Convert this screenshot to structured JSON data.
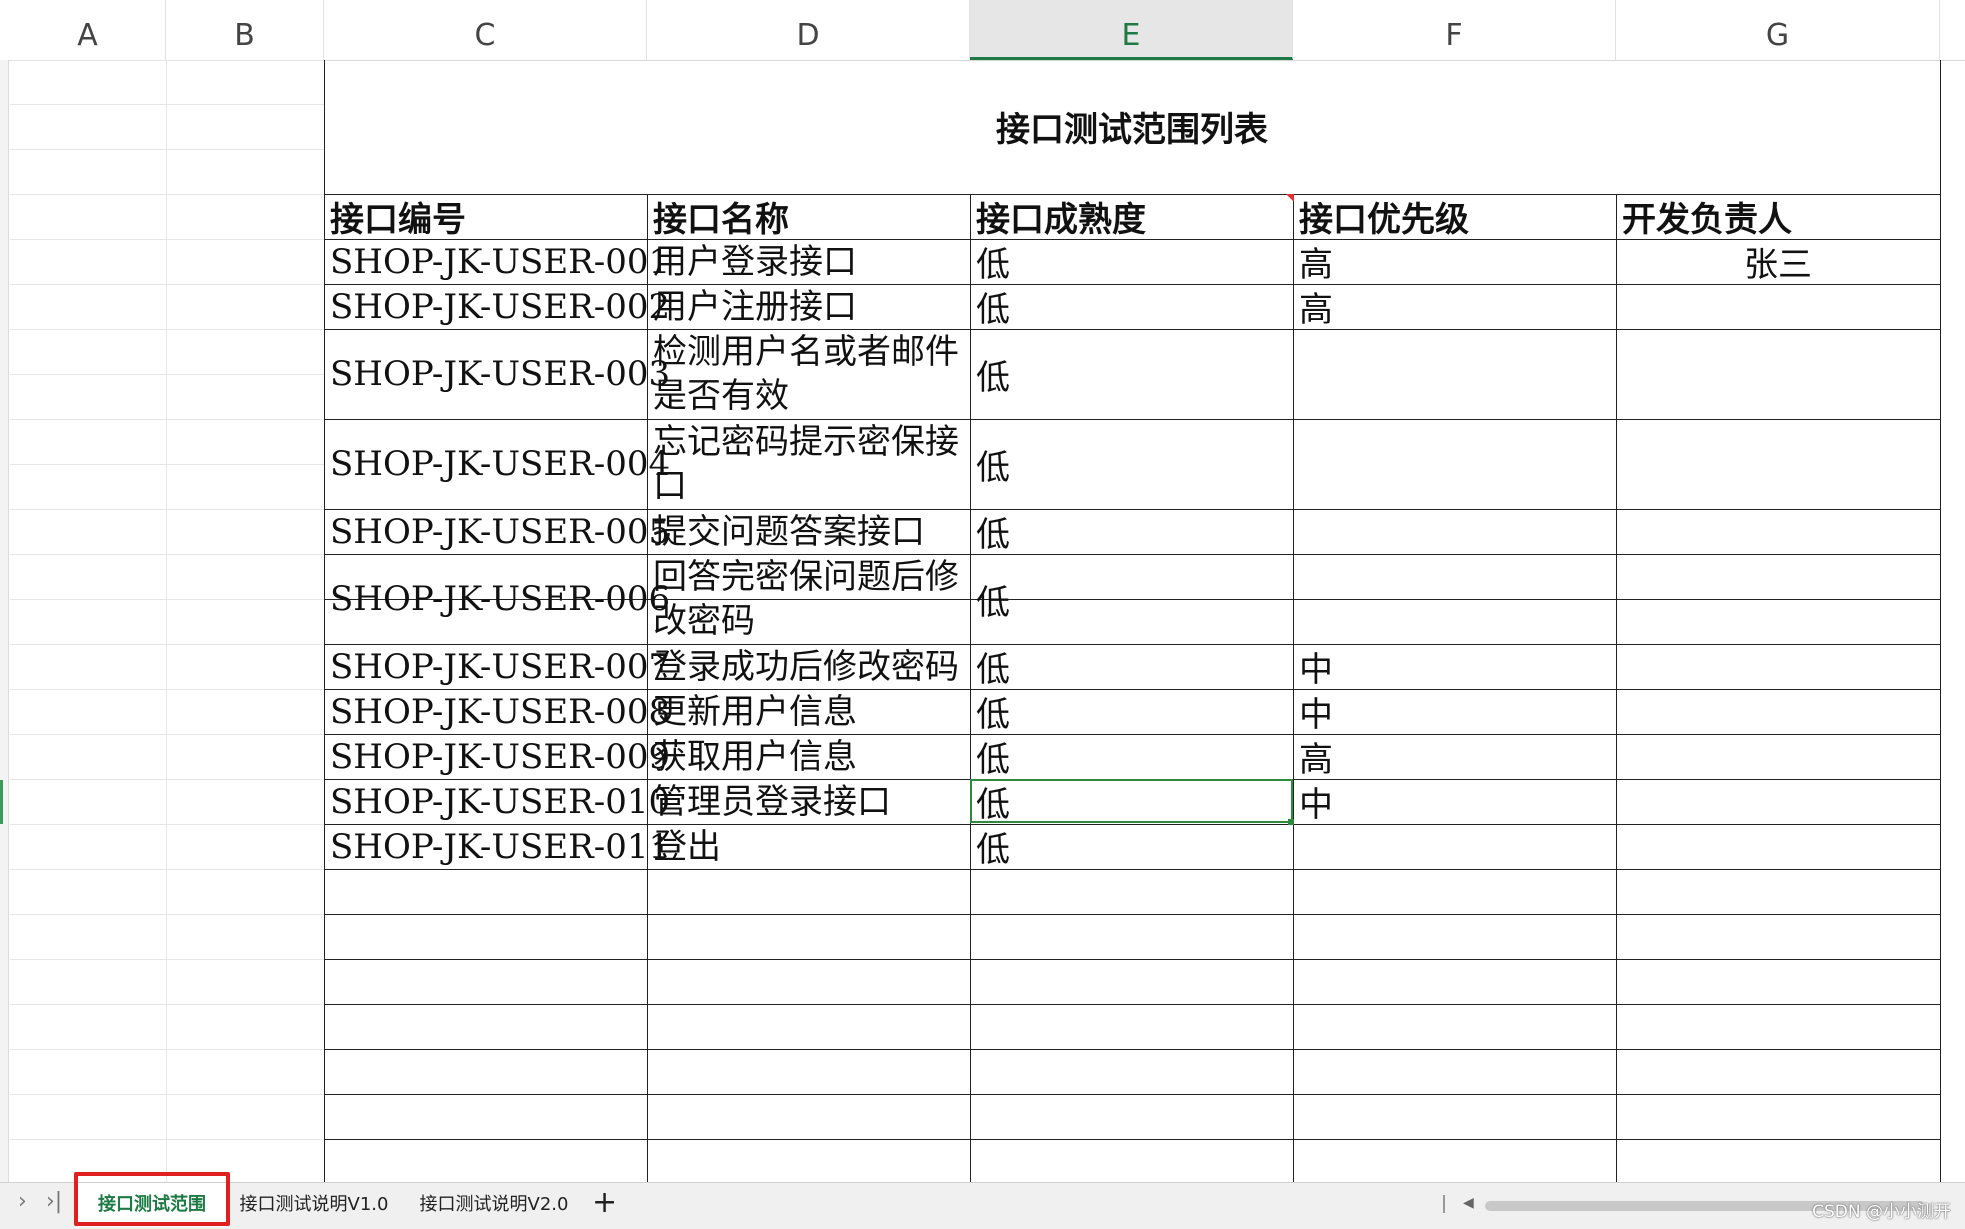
{
  "columns": [
    "A",
    "B",
    "C",
    "D",
    "E",
    "F",
    "G"
  ],
  "active_column": "E",
  "title": "接口测试范围列表",
  "headers": [
    "接口编号",
    "接口名称",
    "接口成熟度",
    "接口优先级",
    "开发负责人"
  ],
  "rows": [
    {
      "id": "SHOP-JK-USER-001",
      "name": "用户登录接口",
      "maturity": "低",
      "priority": "高",
      "owner": "张三"
    },
    {
      "id": "SHOP-JK-USER-002",
      "name": "用户注册接口",
      "maturity": "低",
      "priority": "高",
      "owner": ""
    },
    {
      "id": "SHOP-JK-USER-003",
      "name": "检测用户名或者邮件是否有效",
      "maturity": "低",
      "priority": "",
      "owner": ""
    },
    {
      "id": "SHOP-JK-USER-004",
      "name": "忘记密码提示密保接口",
      "maturity": "低",
      "priority": "",
      "owner": ""
    },
    {
      "id": "SHOP-JK-USER-005",
      "name": "提交问题答案接口",
      "maturity": "低",
      "priority": "",
      "owner": ""
    },
    {
      "id": "SHOP-JK-USER-006",
      "name": "回答完密保问题后修改密码",
      "maturity": "低",
      "priority": "",
      "owner": ""
    },
    {
      "id": "SHOP-JK-USER-007",
      "name": "登录成功后修改密码",
      "maturity": "低",
      "priority": "中",
      "owner": ""
    },
    {
      "id": "SHOP-JK-USER-008",
      "name": "更新用户信息",
      "maturity": "低",
      "priority": "中",
      "owner": ""
    },
    {
      "id": "SHOP-JK-USER-009",
      "name": "获取用户信息",
      "maturity": "低",
      "priority": "高",
      "owner": ""
    },
    {
      "id": "SHOP-JK-USER-010",
      "name": "管理员登录接口",
      "maturity": "低",
      "priority": "中",
      "owner": ""
    },
    {
      "id": "SHOP-JK-USER-011",
      "name": "登出",
      "maturity": "低",
      "priority": "",
      "owner": ""
    }
  ],
  "tabs": [
    "接口测试范围",
    "接口测试说明V1.0",
    "接口测试说明V2.0"
  ],
  "active_tab": "接口测试范围",
  "nav": {
    "prev": "›",
    "last": "›|",
    "add": "+"
  },
  "watermark": "CSDN @小小测开",
  "colors": {
    "accent": "#1e7a45",
    "highlight": "#e02020",
    "selection": "#2e8b3e"
  }
}
